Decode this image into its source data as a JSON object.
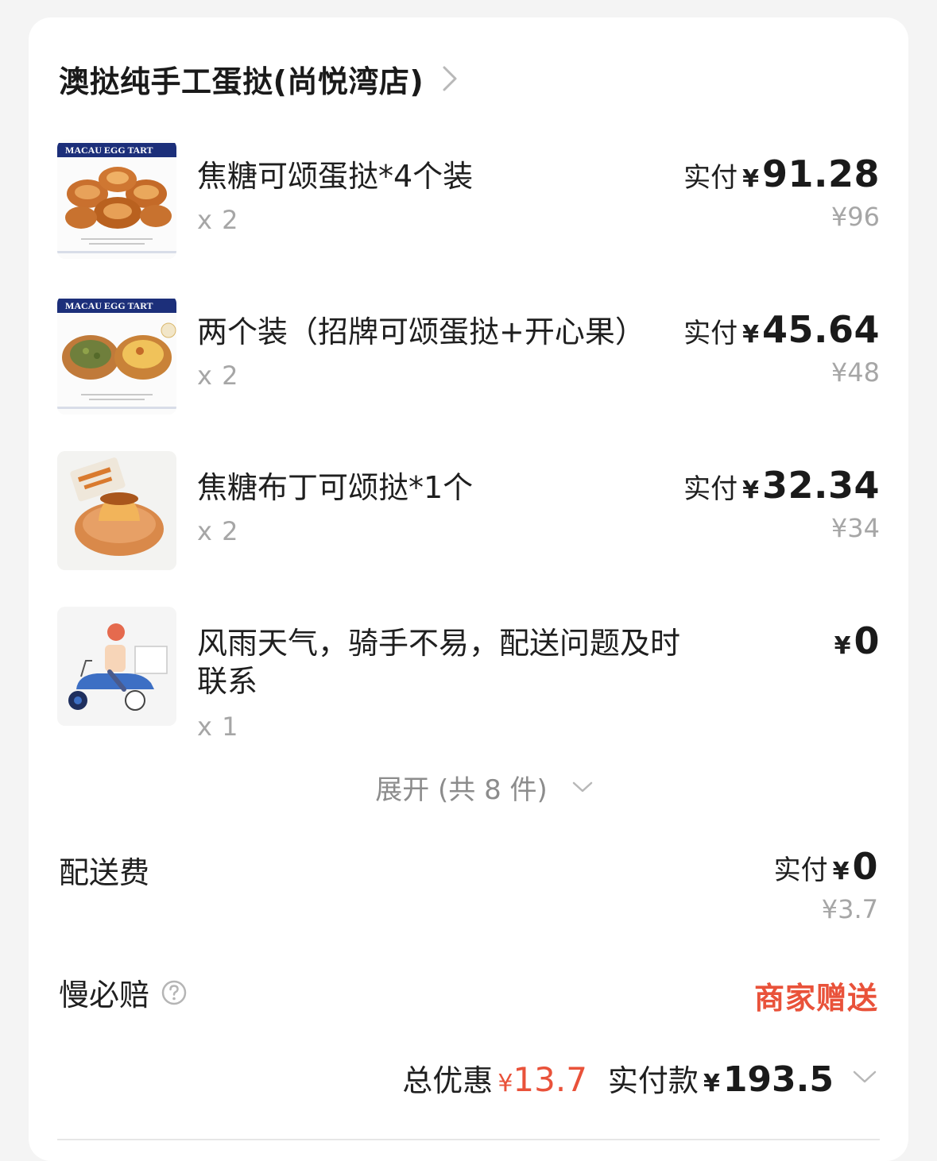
{
  "store": {
    "name": "澳挞纯手工蛋挞(尚悦湾店)"
  },
  "items": [
    {
      "name": "焦糖可颂蛋挞*4个装",
      "qty": "x 2",
      "paid_label": "实付",
      "currency": "¥",
      "paid": "91.28",
      "original": "¥96",
      "image_text": "MACAU EGG TART"
    },
    {
      "name": "两个装（招牌可颂蛋挞+开心果）",
      "qty": "x 2",
      "paid_label": "实付",
      "currency": "¥",
      "paid": "45.64",
      "original": "¥48",
      "image_text": "MACAU EGG TART"
    },
    {
      "name": "焦糖布丁可颂挞*1个",
      "qty": "x 2",
      "paid_label": "实付",
      "currency": "¥",
      "paid": "32.34",
      "original": "¥34"
    },
    {
      "name": "风雨天气，骑手不易，配送问题及时联系",
      "qty": "x 1",
      "currency": "¥",
      "paid": "0"
    }
  ],
  "expand": {
    "label": "展开 (共 8 件)"
  },
  "delivery_fee": {
    "label": "配送费",
    "paid_label": "实付",
    "currency": "¥",
    "paid": "0",
    "original": "¥3.7"
  },
  "late_guarantee": {
    "label": "慢必赔",
    "value": "商家赠送"
  },
  "summary": {
    "discount_label": "总优惠",
    "discount_currency": "¥",
    "discount": "13.7",
    "total_label": "实付款",
    "total_currency": "¥",
    "total": "193.5"
  },
  "colors": {
    "accent_red": "#e9523a",
    "muted": "#a6a6a6",
    "text": "#1f1f1f",
    "background": "#f4f4f4"
  }
}
